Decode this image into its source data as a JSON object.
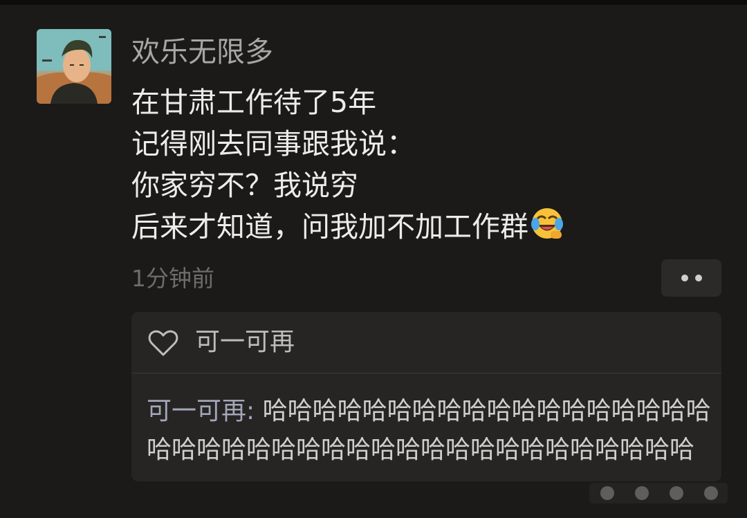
{
  "post": {
    "username": "欢乐无限多",
    "lines": [
      "在甘肃工作待了5年",
      "记得刚去同事跟我说：",
      "你家穷不？我说穷",
      "后来才知道，问我加不加工作群"
    ],
    "emoji_icon": "laughing-crying-emoji-icon",
    "timestamp": "1分钟前"
  },
  "likes": {
    "icon": "heart-icon",
    "names": "可一可再"
  },
  "comments": [
    {
      "author": "可一可再",
      "separator": ": ",
      "text": "哈哈哈哈哈哈哈哈哈哈哈哈哈哈哈哈哈哈哈哈哈哈哈哈哈哈哈哈哈哈哈哈哈哈哈哈哈哈哈哈"
    }
  ],
  "colors": {
    "background": "#1b1a19",
    "panel": "#262524",
    "username": "#a6a6a6",
    "body_text": "#ececec",
    "timestamp": "#6c6c6c",
    "comment_author": "#a3a6b8"
  }
}
